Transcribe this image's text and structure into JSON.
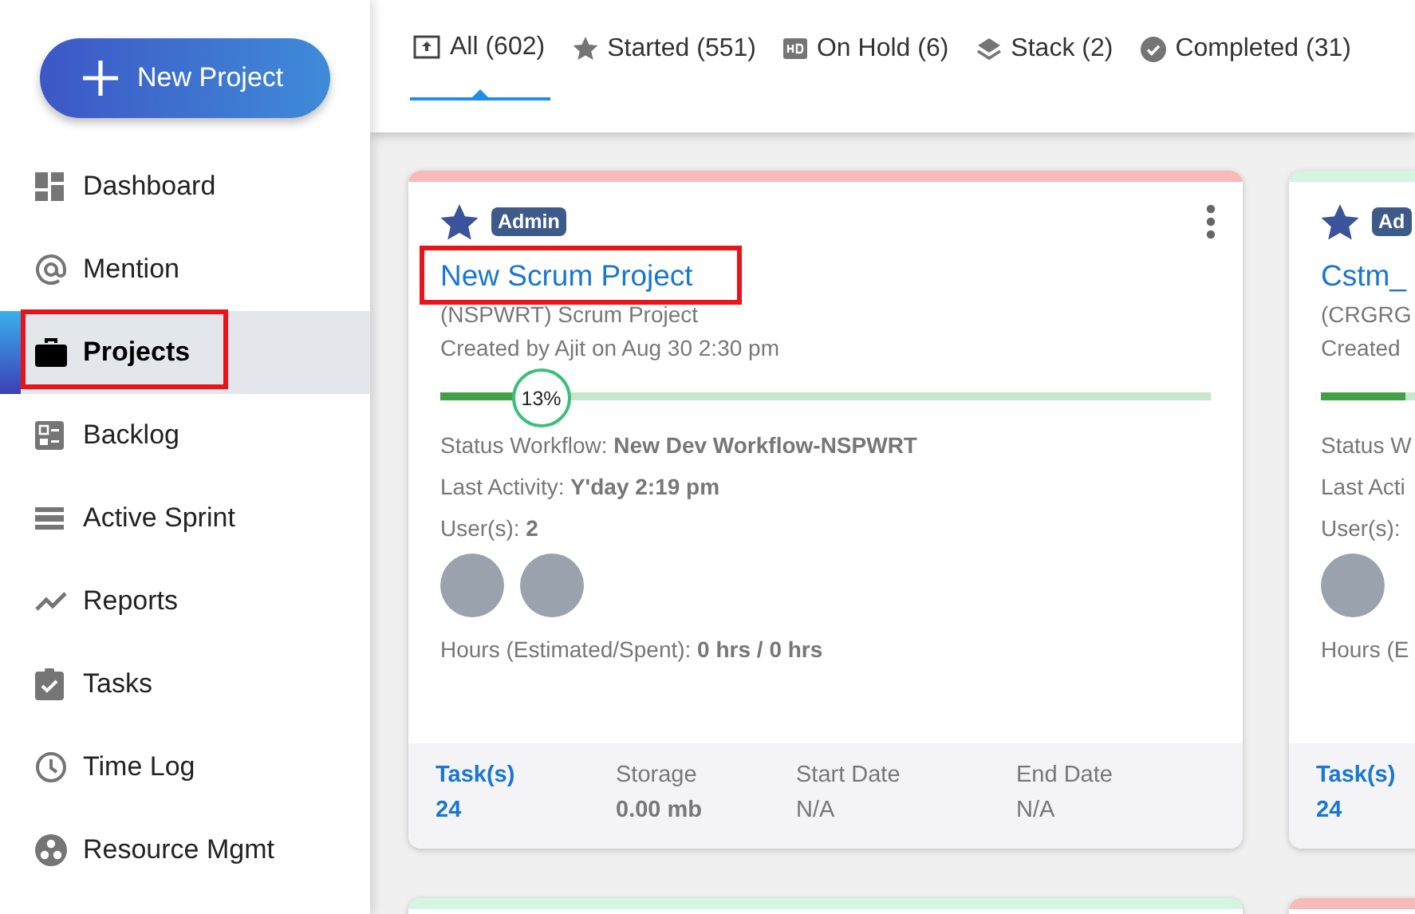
{
  "sidebar": {
    "new_project_button": {
      "label": "New Project"
    },
    "items": [
      {
        "label": "Dashboard",
        "selected": false,
        "annotated": false
      },
      {
        "label": "Mention",
        "selected": false,
        "annotated": false
      },
      {
        "label": "Projects",
        "selected": true,
        "annotated": true
      },
      {
        "label": "Backlog",
        "selected": false,
        "annotated": false
      },
      {
        "label": "Active Sprint",
        "selected": false,
        "annotated": false
      },
      {
        "label": "Reports",
        "selected": false,
        "annotated": false
      },
      {
        "label": "Tasks",
        "selected": false,
        "annotated": false
      },
      {
        "label": "Time Log",
        "selected": false,
        "annotated": false
      },
      {
        "label": "Resource Mgmt",
        "selected": false,
        "annotated": false
      }
    ]
  },
  "tabs": [
    {
      "label": "All (602)",
      "selected": true
    },
    {
      "label": "Started (551)",
      "selected": false
    },
    {
      "label": "On Hold (6)",
      "selected": false
    },
    {
      "label": "Stack (2)",
      "selected": false
    },
    {
      "label": "Completed (31)",
      "selected": false
    }
  ],
  "cards": [
    {
      "color": "#f8b9b9",
      "starred": true,
      "badge": "Admin",
      "menu": true,
      "title": "New Scrum Project",
      "annotated": true,
      "subtitle": "(NSPWRT) Scrum Project",
      "created": "Created by Ajit on Aug 30 2:30 pm",
      "progress": {
        "level": 0.13,
        "label": "13%"
      },
      "details": [
        {
          "kind": "text",
          "label": "Status Workflow:",
          "value": "New Dev Workflow-NSPWRT"
        },
        {
          "kind": "text",
          "label": "Last Activity:",
          "value": "Y'day 2:19 pm"
        },
        {
          "kind": "text",
          "label": "User(s):",
          "value": "2"
        },
        {
          "kind": "avatars",
          "users": [
            {
              "kind": "photo"
            },
            {
              "kind": "photo"
            }
          ]
        },
        {
          "kind": "text",
          "label": "Hours (Estimated/Spent):",
          "value": "0 hrs / 0 hrs"
        }
      ],
      "stats": [
        {
          "kind": "link",
          "label": "Task(s)",
          "value": "24"
        },
        {
          "kind": "bold",
          "label": "Storage",
          "value": "0.00 mb"
        },
        {
          "kind": "plain",
          "label": "Start Date",
          "value": "N/A"
        },
        {
          "kind": "plain",
          "label": "End Date",
          "value": "N/A"
        }
      ]
    },
    {
      "color": "#d5f5e3",
      "starred": true,
      "badge": "Ad",
      "title": "Cstm_",
      "subtitle": "(CRGRG",
      "created": "Created",
      "progress": {
        "level": 0.11
      },
      "details": [
        {
          "kind": "text",
          "label": "Status W"
        },
        {
          "kind": "text",
          "label": "Last Acti"
        },
        {
          "kind": "text",
          "label": "User(s):"
        },
        {
          "kind": "avatars",
          "users": [
            {
              "kind": "photo"
            }
          ]
        },
        {
          "kind": "text",
          "label": "Hours (E"
        }
      ],
      "stats": [
        {
          "kind": "link",
          "label": "Task(s)",
          "value": "24"
        }
      ]
    },
    {
      "color": "#d5f5e3"
    },
    {
      "color": "#f8b9b9"
    }
  ]
}
